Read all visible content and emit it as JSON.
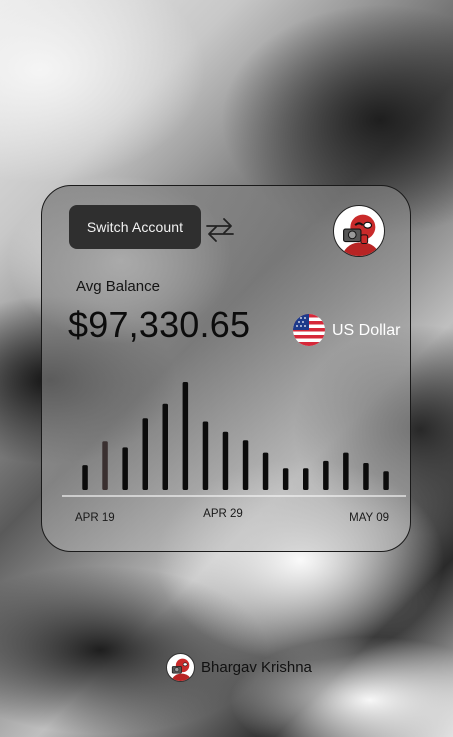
{
  "card": {
    "switch_account_label": "Switch Account",
    "swap_icon": "swap-arrows-icon",
    "avatar_icon": "user-avatar"
  },
  "balance": {
    "label": "Avg Balance",
    "amount": "$97,330.65"
  },
  "currency": {
    "flag_icon": "us-flag-icon",
    "name": "US Dollar"
  },
  "chart_data": {
    "type": "bar",
    "values": [
      24,
      47,
      41,
      69,
      83,
      104,
      66,
      56,
      48,
      36,
      21,
      21,
      28,
      36,
      26,
      18
    ],
    "highlight_index": 1,
    "bar_color": "#0b0b0b",
    "highlight_color": "#3a3030",
    "tick_labels": [
      "APR 19",
      "APR 29",
      "MAY 09"
    ],
    "xlabel": "",
    "ylabel": "",
    "grid": false
  },
  "footer": {
    "user_name": "Bhargav Krishna"
  }
}
